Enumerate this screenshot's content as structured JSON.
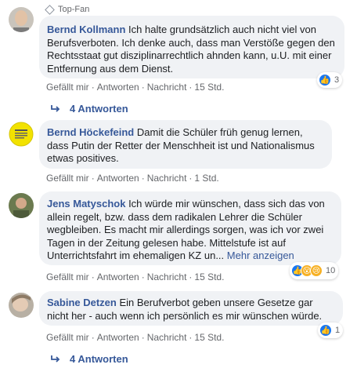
{
  "top_fan_label": "Top-Fan",
  "comments": [
    {
      "author": "Bernd Kollmann",
      "text": "Ich halte grundsätzlich auch nicht viel von Berufsverboten. Ich denke auch, dass man Verstöße gegen den Rechtsstaat gut disziplinarrechtlich ahnden kann, u.U. mit einer Entfernung aus dem Dienst.",
      "actions": {
        "like": "Gefällt mir",
        "reply": "Antworten",
        "message": "Nachricht",
        "time": "15 Std."
      },
      "reaction_count": "3",
      "replies_label": "4 Antworten"
    },
    {
      "author": "Bernd Höckefeind",
      "text": "Damit die Schüler früh genug lernen, dass Putin der Retter der Menschheit ist und Nationalismus etwas positives.",
      "actions": {
        "like": "Gefällt mir",
        "reply": "Antworten",
        "message": "Nachricht",
        "time": "1 Std."
      }
    },
    {
      "author": "Jens Matyschok",
      "text": "Ich würde mir wünschen, dass sich das von allein regelt, bzw. dass dem radikalen Lehrer die Schüler wegbleiben. Es macht mir allerdings sorgen, was ich vor zwei Tagen in der Zeitung gelesen habe. Mittelstufe ist auf Unterrichtsfahrt im ehemaligen KZ un...",
      "more": "Mehr anzeigen",
      "actions": {
        "like": "Gefällt mir",
        "reply": "Antworten",
        "message": "Nachricht",
        "time": "15 Std."
      },
      "reaction_count": "10"
    },
    {
      "author": "Sabine Detzen",
      "text": "Ein Berufverbot geben unsere Gesetze gar nicht her - auch wenn ich persönlich es mir wünschen würde.",
      "actions": {
        "like": "Gefällt mir",
        "reply": "Antworten",
        "message": "Nachricht",
        "time": "15 Std."
      },
      "reaction_count": "1",
      "replies_label": "4 Antworten"
    }
  ],
  "colors": {
    "link": "#365899",
    "bubble": "#f0f2f5",
    "meta": "#65676b",
    "like": "#1877f2"
  }
}
